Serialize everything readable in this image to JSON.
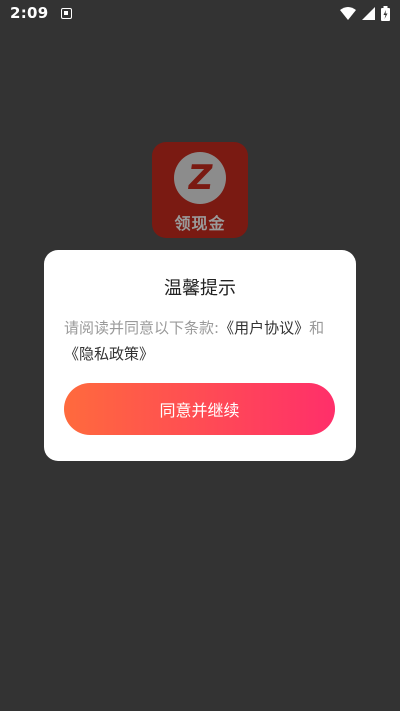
{
  "status_bar": {
    "time": "2:09",
    "icons": [
      "notification-icon",
      "wifi-icon",
      "signal-icon",
      "battery-icon"
    ]
  },
  "app": {
    "logo_letter": "Z",
    "logo_text": "领现金"
  },
  "dialog": {
    "title": "温馨提示",
    "message_prefix": "请阅读并同意以下条款:",
    "user_agreement_link": "《用户协议》",
    "conjunction": "和",
    "privacy_policy_link": "《隐私政策》",
    "agree_button_label": "同意并继续"
  },
  "colors": {
    "background_overlay": "#333333",
    "button_gradient_start": "#ff6a3d",
    "button_gradient_end": "#ff2f6a",
    "logo_background": "#7a1a12"
  }
}
